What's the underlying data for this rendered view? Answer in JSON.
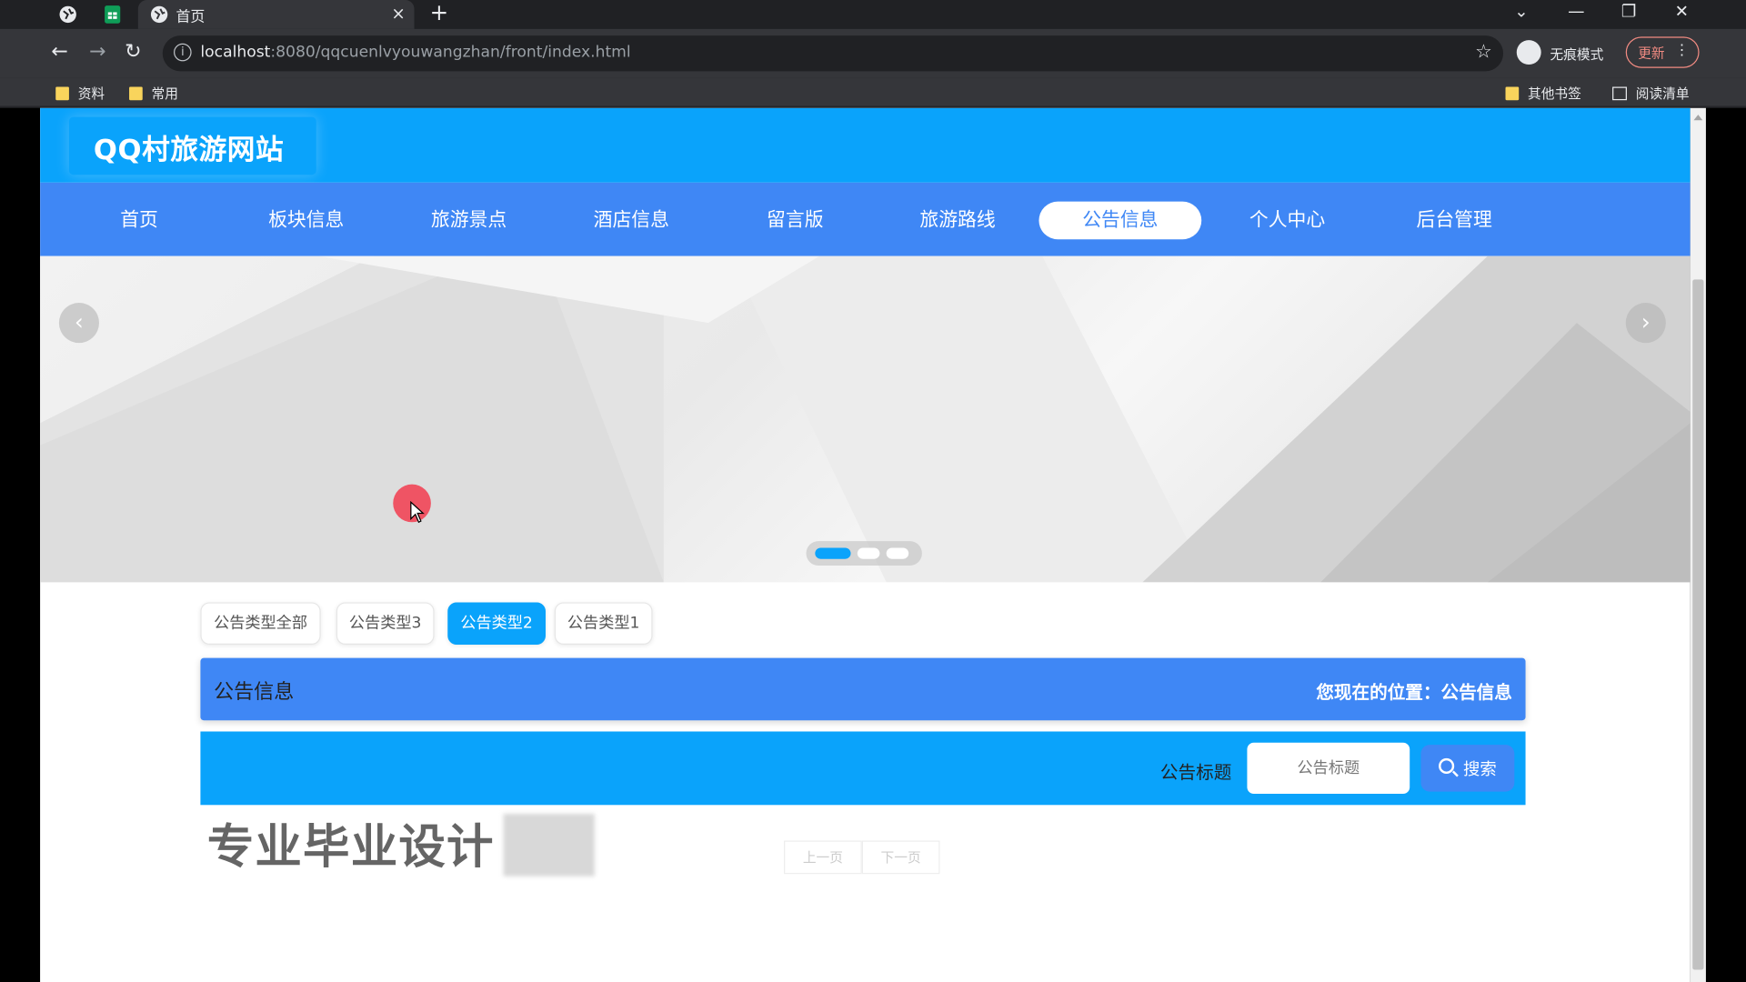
{
  "browser": {
    "tab": {
      "title": "首页",
      "close": "×"
    },
    "new_tab": "+",
    "window_controls": {
      "dropdown": "⌄",
      "minimize": "—",
      "restore": "❐",
      "close": "✕"
    },
    "nav": {
      "back": "←",
      "forward": "→",
      "reload": "↻"
    },
    "url": {
      "host": "localhost",
      "rest": ":8080/qqcuenlvyouwangzhan/front/index.html",
      "info_icon": "i"
    },
    "star": "☆",
    "incognito_label": "无痕模式",
    "update_label": "更新",
    "menu": "⋮",
    "bookmarks": [
      "资料",
      "常用"
    ],
    "other_bookmarks": "其他书签",
    "reading_list": "阅读清单"
  },
  "site": {
    "title": "QQ村旅游网站",
    "nav": [
      "首页",
      "板块信息",
      "旅游景点",
      "酒店信息",
      "留言版",
      "旅游路线",
      "公告信息",
      "个人中心",
      "后台管理"
    ],
    "active_nav_index": 6,
    "banner": {
      "prev": "‹",
      "next": "›",
      "slide_count": 3,
      "active_slide": 1
    }
  },
  "filters": {
    "items": [
      "公告类型全部",
      "公告类型3",
      "公告类型2",
      "公告类型1"
    ],
    "active_index": 2
  },
  "section": {
    "title": "公告信息",
    "breadcrumb": "您现在的位置：公告信息"
  },
  "search": {
    "label": "公告标题",
    "placeholder": "公告标题",
    "button": "搜索"
  },
  "pager": {
    "prev": "上一页",
    "next": "下一页"
  },
  "watermark": "专业毕业设计"
}
